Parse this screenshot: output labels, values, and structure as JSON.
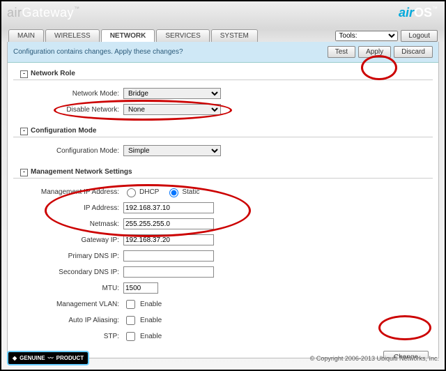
{
  "brand_prefix": "air",
  "brand_main": "Gateway",
  "brand_tm": "™",
  "airos_air": "air",
  "airos_os": "OS",
  "tabs": {
    "main": "MAIN",
    "wireless": "WIRELESS",
    "network": "NETWORK",
    "services": "SERVICES",
    "system": "SYSTEM"
  },
  "tools_label": "Tools:",
  "logout": "Logout",
  "notice_text": "Configuration contains changes. Apply these changes?",
  "btn_test": "Test",
  "btn_apply": "Apply",
  "btn_discard": "Discard",
  "sec_network_role": "Network Role",
  "lbl_network_mode": "Network Mode:",
  "val_network_mode": "Bridge",
  "lbl_disable_network": "Disable Network:",
  "val_disable_network": "None",
  "sec_config_mode": "Configuration Mode",
  "lbl_config_mode": "Configuration Mode:",
  "val_config_mode": "Simple",
  "sec_mgmt": "Management Network Settings",
  "lbl_mgmt_ip": "Management IP Address:",
  "radio_dhcp": "DHCP",
  "radio_static": "Static",
  "lbl_ip": "IP Address:",
  "val_ip": "192.168.37.10",
  "lbl_netmask": "Netmask:",
  "val_netmask": "255.255.255.0",
  "lbl_gateway": "Gateway IP:",
  "val_gateway": "192.168.37.20",
  "lbl_dns1": "Primary DNS IP:",
  "val_dns1": "",
  "lbl_dns2": "Secondary DNS IP:",
  "val_dns2": "",
  "lbl_mtu": "MTU:",
  "val_mtu": "1500",
  "lbl_vlan": "Management VLAN:",
  "lbl_autoip": "Auto IP Aliasing:",
  "lbl_stp": "STP:",
  "enable": "Enable",
  "btn_change": "Change",
  "genuine": "GENUINE",
  "genuine2": "PRODUCT",
  "copyright": "© Copyright 2006-2013 Ubiquiti Networks, Inc."
}
